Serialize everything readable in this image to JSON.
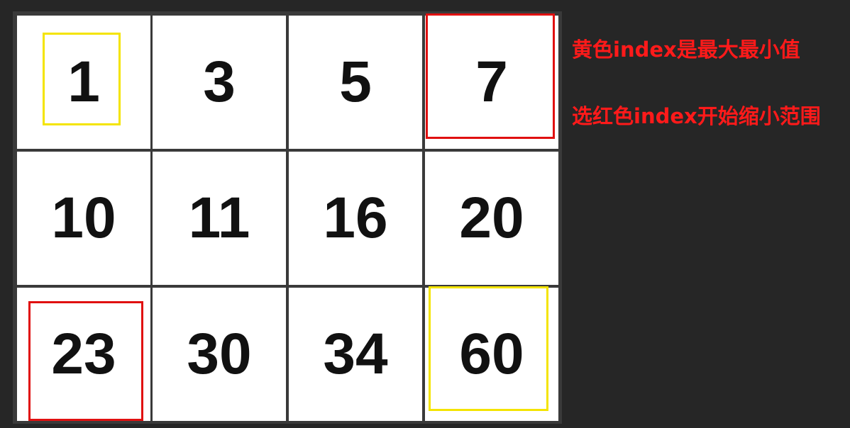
{
  "matrix": {
    "rows": [
      [
        1,
        3,
        5,
        7
      ],
      [
        10,
        11,
        16,
        20
      ],
      [
        23,
        30,
        34,
        60
      ]
    ]
  },
  "highlights": {
    "yellow": {
      "color": "#f4e400",
      "cells": [
        [
          0,
          0
        ],
        [
          2,
          3
        ]
      ]
    },
    "red": {
      "color": "#e01010",
      "cells": [
        [
          0,
          3
        ],
        [
          2,
          0
        ]
      ]
    }
  },
  "notes": {
    "line1": "黄色index是最大最小值",
    "line2": "选红色index开始缩小范围"
  }
}
